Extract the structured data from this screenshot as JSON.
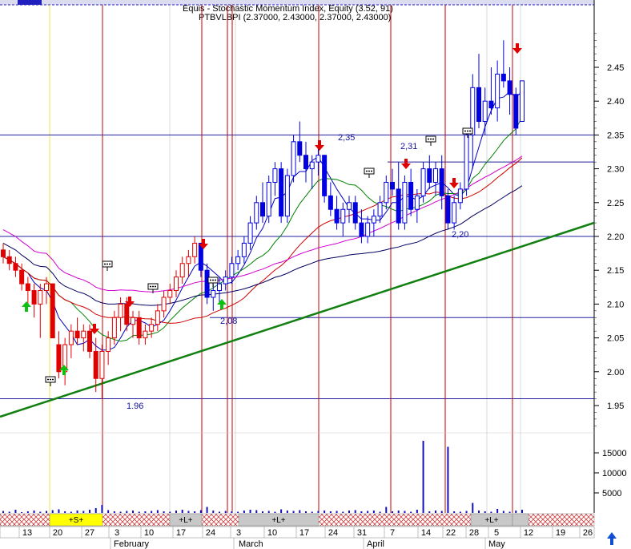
{
  "chart_data": {
    "type": "candlestick",
    "header": {
      "line1": "Equis - Stochastic Momentum Index, Equity (3.52, 91)",
      "line2": "PTBVLBPI (2.37000, 2.43000, 2.37000, 2.43000)"
    },
    "y_ticks": [
      "2.45",
      "2.40",
      "2.35",
      "2.30",
      "2.25",
      "2.20",
      "2.15",
      "2.10",
      "2.05",
      "2.00",
      "1.95"
    ],
    "y_range": [
      1.92,
      2.5
    ],
    "volume_ticks": [
      "15000",
      "10000",
      "5000"
    ],
    "volume_range": [
      0,
      20000
    ],
    "annotations": [
      "2,35",
      "2,31",
      "2,20",
      "2,08",
      "1.96"
    ],
    "date_labels": [
      "13",
      "20",
      "27",
      "3",
      "10",
      "17",
      "24",
      "3",
      "10",
      "17",
      "24",
      "31",
      "7",
      "14",
      "22",
      "28",
      "5",
      "12",
      "19",
      "26"
    ],
    "months": [
      "February",
      "March",
      "April",
      "May"
    ],
    "strip_labels": [
      "+S+",
      "+L+",
      "+L+",
      "+L+"
    ],
    "ohlc": [
      [
        2.18,
        2.19,
        2.16,
        2.17
      ],
      [
        2.17,
        2.18,
        2.15,
        2.16
      ],
      [
        2.16,
        2.17,
        2.14,
        2.15
      ],
      [
        2.15,
        2.16,
        2.12,
        2.13
      ],
      [
        2.13,
        2.14,
        2.1,
        2.12
      ],
      [
        2.12,
        2.13,
        2.08,
        2.1
      ],
      [
        2.1,
        2.13,
        2.05,
        2.12
      ],
      [
        2.12,
        2.14,
        2.1,
        2.13
      ],
      [
        2.13,
        2.13,
        2.05,
        2.05
      ],
      [
        2.04,
        2.06,
        1.99,
        2.0
      ],
      [
        2.0,
        2.05,
        1.98,
        2.04
      ],
      [
        2.04,
        2.07,
        2.02,
        2.06
      ],
      [
        2.06,
        2.08,
        2.04,
        2.05
      ],
      [
        2.05,
        2.07,
        2.03,
        2.06
      ],
      [
        2.06,
        2.07,
        2.02,
        2.03
      ],
      [
        2.03,
        2.05,
        1.97,
        1.99
      ],
      [
        1.99,
        2.04,
        1.96,
        2.03
      ],
      [
        2.03,
        2.06,
        2.01,
        2.05
      ],
      [
        2.05,
        2.09,
        2.04,
        2.08
      ],
      [
        2.08,
        2.11,
        2.06,
        2.1
      ],
      [
        2.1,
        2.11,
        2.06,
        2.07
      ],
      [
        2.07,
        2.09,
        2.05,
        2.08
      ],
      [
        2.08,
        2.09,
        2.04,
        2.05
      ],
      [
        2.05,
        2.07,
        2.04,
        2.06
      ],
      [
        2.06,
        2.08,
        2.05,
        2.07
      ],
      [
        2.07,
        2.1,
        2.06,
        2.09
      ],
      [
        2.09,
        2.12,
        2.08,
        2.11
      ],
      [
        2.11,
        2.13,
        2.1,
        2.12
      ],
      [
        2.12,
        2.15,
        2.11,
        2.14
      ],
      [
        2.14,
        2.17,
        2.13,
        2.16
      ],
      [
        2.16,
        2.18,
        2.14,
        2.17
      ],
      [
        2.17,
        2.2,
        2.16,
        2.19
      ],
      [
        2.19,
        2.19,
        2.14,
        2.15
      ],
      [
        2.15,
        2.16,
        2.1,
        2.11
      ],
      [
        2.11,
        2.13,
        2.09,
        2.12
      ],
      [
        2.12,
        2.14,
        2.1,
        2.13
      ],
      [
        2.13,
        2.15,
        2.12,
        2.14
      ],
      [
        2.14,
        2.17,
        2.13,
        2.16
      ],
      [
        2.16,
        2.18,
        2.15,
        2.17
      ],
      [
        2.17,
        2.2,
        2.16,
        2.19
      ],
      [
        2.19,
        2.23,
        2.18,
        2.22
      ],
      [
        2.22,
        2.26,
        2.21,
        2.25
      ],
      [
        2.25,
        2.28,
        2.22,
        2.23
      ],
      [
        2.23,
        2.29,
        2.22,
        2.28
      ],
      [
        2.28,
        2.31,
        2.26,
        2.3
      ],
      [
        2.3,
        2.31,
        2.22,
        2.23
      ],
      [
        2.23,
        2.3,
        2.22,
        2.29
      ],
      [
        2.29,
        2.35,
        2.28,
        2.34
      ],
      [
        2.34,
        2.37,
        2.31,
        2.32
      ],
      [
        2.32,
        2.34,
        2.28,
        2.3
      ],
      [
        2.3,
        2.32,
        2.27,
        2.31
      ],
      [
        2.31,
        2.33,
        2.29,
        2.32
      ],
      [
        2.32,
        2.32,
        2.25,
        2.26
      ],
      [
        2.26,
        2.28,
        2.23,
        2.24
      ],
      [
        2.24,
        2.26,
        2.21,
        2.22
      ],
      [
        2.22,
        2.25,
        2.2,
        2.24
      ],
      [
        2.24,
        2.26,
        2.22,
        2.25
      ],
      [
        2.25,
        2.26,
        2.21,
        2.22
      ],
      [
        2.22,
        2.24,
        2.19,
        2.2
      ],
      [
        2.2,
        2.23,
        2.19,
        2.22
      ],
      [
        2.22,
        2.24,
        2.2,
        2.23
      ],
      [
        2.23,
        2.26,
        2.22,
        2.25
      ],
      [
        2.25,
        2.29,
        2.24,
        2.28
      ],
      [
        2.28,
        2.3,
        2.26,
        2.27
      ],
      [
        2.27,
        2.31,
        2.21,
        2.22
      ],
      [
        2.22,
        2.29,
        2.21,
        2.28
      ],
      [
        2.28,
        2.3,
        2.23,
        2.24
      ],
      [
        2.24,
        2.27,
        2.22,
        2.26
      ],
      [
        2.26,
        2.31,
        2.25,
        2.3
      ],
      [
        2.3,
        2.32,
        2.27,
        2.28
      ],
      [
        2.28,
        2.31,
        2.26,
        2.3
      ],
      [
        2.3,
        2.32,
        2.24,
        2.26
      ],
      [
        2.26,
        2.27,
        2.21,
        2.22
      ],
      [
        2.22,
        2.26,
        2.21,
        2.25
      ],
      [
        2.25,
        2.28,
        2.24,
        2.27
      ],
      [
        2.27,
        2.36,
        2.26,
        2.35
      ],
      [
        2.35,
        2.44,
        2.3,
        2.42
      ],
      [
        2.42,
        2.47,
        2.36,
        2.37
      ],
      [
        2.37,
        2.42,
        2.35,
        2.4
      ],
      [
        2.4,
        2.45,
        2.38,
        2.39
      ],
      [
        2.39,
        2.46,
        2.37,
        2.44
      ],
      [
        2.44,
        2.49,
        2.42,
        2.43
      ],
      [
        2.43,
        2.45,
        2.38,
        2.41
      ],
      [
        2.41,
        2.42,
        2.35,
        2.36
      ],
      [
        2.37,
        2.43,
        2.37,
        2.43
      ]
    ],
    "volume": [
      500,
      300,
      800,
      200,
      400,
      600,
      300,
      500,
      700,
      900,
      400,
      300,
      600,
      500,
      800,
      1200,
      2000,
      700,
      400,
      300,
      500,
      600,
      300,
      400,
      500,
      700,
      400,
      300,
      600,
      800,
      500,
      400,
      700,
      1500,
      600,
      300,
      500,
      400,
      300,
      600,
      800,
      700,
      400,
      500,
      300,
      900,
      600,
      500,
      700,
      400,
      300,
      500,
      600,
      400,
      500,
      300,
      600,
      700,
      400,
      500,
      600,
      300,
      1500,
      400,
      600,
      500,
      300,
      800,
      18000,
      400,
      600,
      500,
      16500,
      400,
      300,
      500,
      2500,
      600,
      400,
      300,
      1000,
      500,
      300,
      600,
      800
    ]
  }
}
